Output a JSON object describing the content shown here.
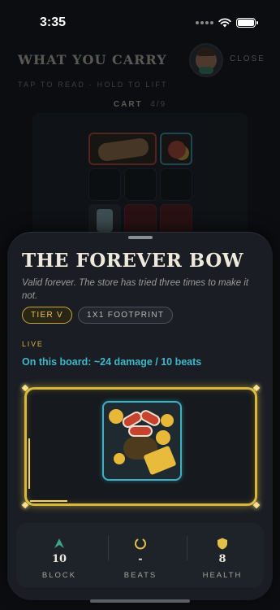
{
  "status_bar": {
    "time": "3:35"
  },
  "background": {
    "title": "WHAT YOU CARRY",
    "close_label": "CLOSE",
    "subtitle": "TAP TO READ - HOLD TO LIFT",
    "cart_label": "CART",
    "cart_count": "4/9"
  },
  "sheet": {
    "title": "THE FOREVER BOW",
    "description": "Valid forever. The store has tried three times to make it not.",
    "chips": {
      "tier": "TIER V",
      "footprint": "1X1 FOOTPRINT"
    },
    "live_label": "LIVE",
    "live_value": "On this board: ~24 damage / 10 beats",
    "stats": [
      {
        "value": "10",
        "label": "BLOCK",
        "icon": "arrow-up-icon",
        "color": "#3fa38a"
      },
      {
        "value": "-",
        "label": "BEATS",
        "icon": "ring-icon",
        "color": "#e2c14a"
      },
      {
        "value": "8",
        "label": "HEALTH",
        "icon": "shield-icon",
        "color": "#e2c14a"
      }
    ]
  },
  "colors": {
    "gold": "#d9b73a",
    "teal": "#40b7c9",
    "panel": "#1a1e24"
  }
}
